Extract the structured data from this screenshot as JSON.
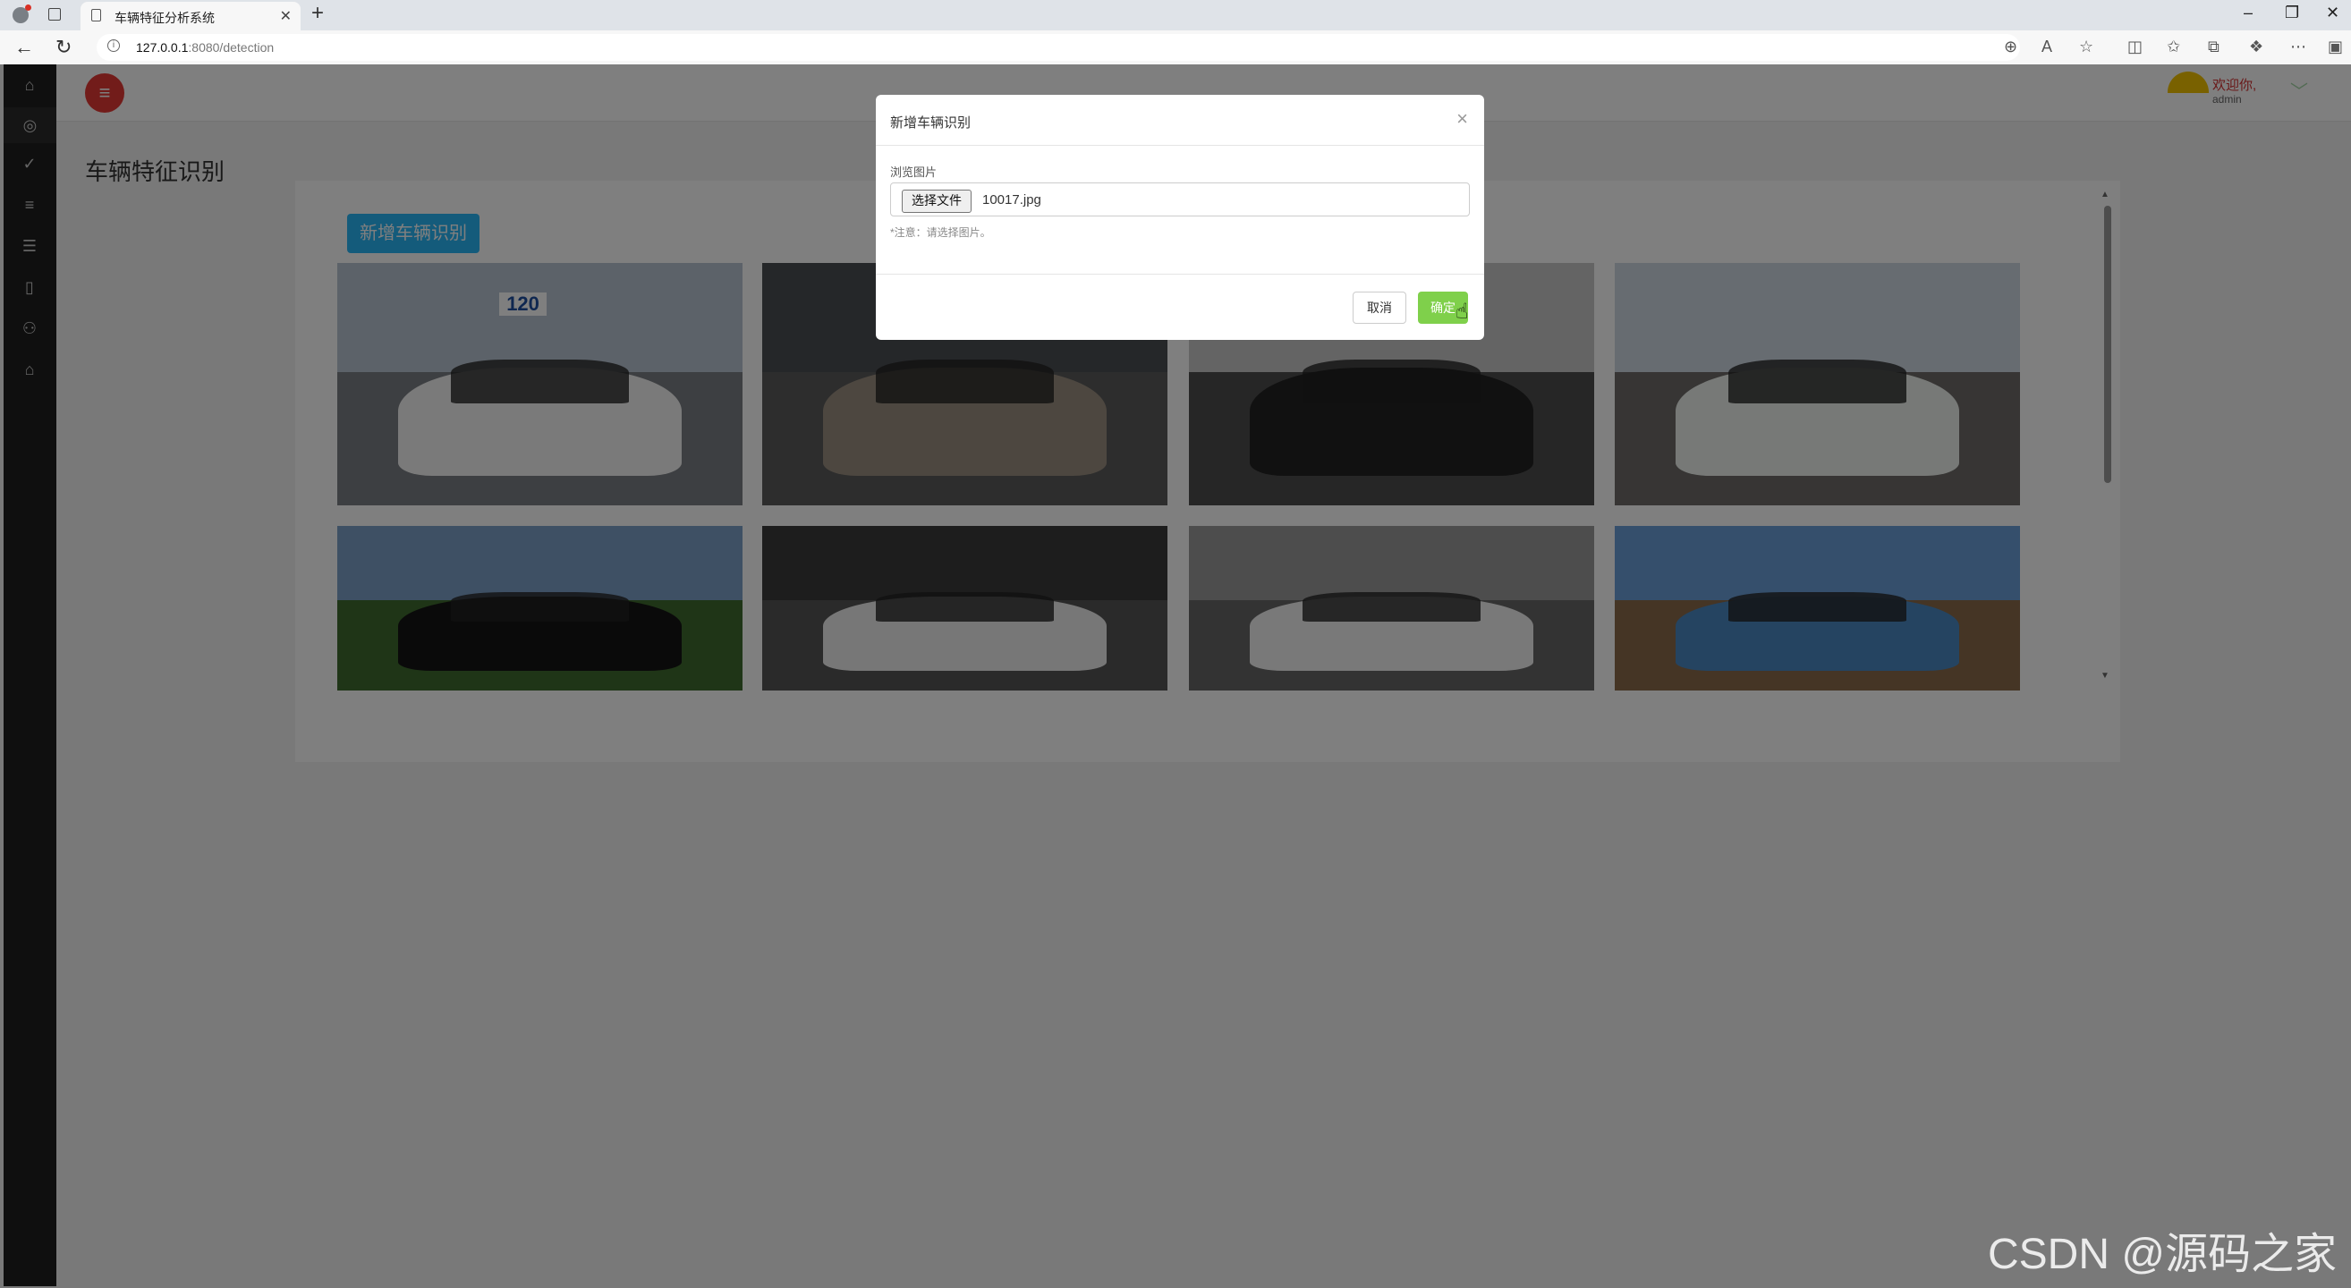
{
  "browser": {
    "tab_title": "车辆特征分析系统",
    "url_host": "127.0.0.1",
    "url_rest": ":8080/detection"
  },
  "header": {
    "welcome": "欢迎你,",
    "username": "admin"
  },
  "page": {
    "title": "车辆特征识别",
    "add_button": "新增车辆识别"
  },
  "gallery": [
    {
      "caption": "120",
      "sky": "#b9c5d2",
      "ground": "#7b7f84",
      "car": "#f4f4f4"
    },
    {
      "caption": "",
      "sky": "#4b4e53",
      "ground": "#5a5a5a",
      "car": "#9a8f80"
    },
    {
      "caption": "",
      "sky": "#c8c8c8",
      "ground": "#4d4d4d",
      "car": "#222222"
    },
    {
      "caption": "",
      "sky": "#cfd9e3",
      "ground": "#6e6b68",
      "car": "#eef3ef"
    },
    {
      "caption": "",
      "sky": "#7da0c8",
      "ground": "#3e6b2e",
      "car": "#151515"
    },
    {
      "caption": "",
      "sky": "#3a3a3a",
      "ground": "#555555",
      "car": "#efefef"
    },
    {
      "caption": "",
      "sky": "#9a9a9a",
      "ground": "#666666",
      "car": "#f2f2f2"
    },
    {
      "caption": "",
      "sky": "#6a9fd8",
      "ground": "#8a6a4a",
      "car": "#4a88c2"
    }
  ],
  "modal": {
    "title": "新增车辆识别",
    "field_label": "浏览图片",
    "file_button": "选择文件",
    "file_name": "10017.jpg",
    "note": "*注意：请选择图片。",
    "cancel": "取消",
    "confirm": "确定"
  },
  "watermark": "CSDN @源码之家",
  "colors": {
    "accent_red": "#e53935",
    "primary_blue": "#29b6f6",
    "confirm_green": "#7fd04b"
  }
}
